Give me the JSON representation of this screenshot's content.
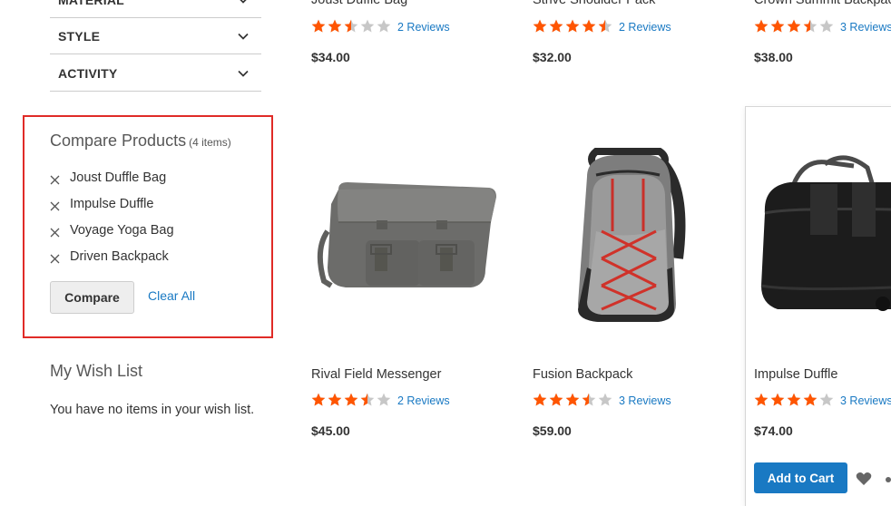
{
  "filters": [
    {
      "label": "MATERIAL"
    },
    {
      "label": "STYLE"
    },
    {
      "label": "ACTIVITY"
    }
  ],
  "compare": {
    "title": "Compare Products",
    "count": "(4 items)",
    "items": [
      "Joust Duffle Bag",
      "Impulse Duffle",
      "Voyage Yoga Bag",
      "Driven Backpack"
    ],
    "compare_button": "Compare",
    "clear_all": "Clear All"
  },
  "wishlist": {
    "title": "My Wish List",
    "empty_text": "You have no items in your wish list."
  },
  "products_top": [
    {
      "name": "Joust Duffle Bag",
      "rating": 2.5,
      "reviews": "2 Reviews",
      "price": "$34.00"
    },
    {
      "name": "Strive Shoulder Pack",
      "rating": 4.5,
      "reviews": "2 Reviews",
      "price": "$32.00"
    },
    {
      "name": "Crown Summit Backpack",
      "rating": 3.5,
      "reviews": "3 Reviews",
      "price": "$38.00"
    }
  ],
  "products": [
    {
      "name": "Rival Field Messenger",
      "rating": 3.5,
      "reviews": "2 Reviews",
      "price": "$45.00"
    },
    {
      "name": "Fusion Backpack",
      "rating": 3.5,
      "reviews": "3 Reviews",
      "price": "$59.00"
    },
    {
      "name": "Impulse Duffle",
      "rating": 4,
      "reviews": "3 Reviews",
      "price": "$74.00",
      "add_to_cart": "Add to Cart"
    }
  ],
  "colors": {
    "star_on": "#ff5501",
    "star_off": "#c7c7c7",
    "link": "#1979c3",
    "highlight": "#e02b27"
  }
}
